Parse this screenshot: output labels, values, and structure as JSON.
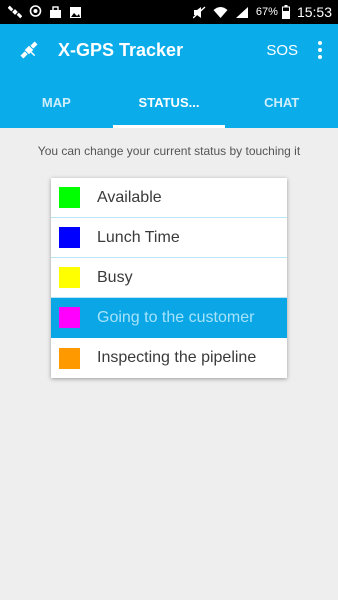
{
  "status_bar": {
    "battery": "67%",
    "time": "15:53"
  },
  "app_bar": {
    "title": "X-GPS Tracker",
    "sos_label": "SOS"
  },
  "tabs": [
    {
      "label": "MAP"
    },
    {
      "label": "STATUS..."
    },
    {
      "label": "CHAT"
    }
  ],
  "hint": "You can change your current status by touching it",
  "statuses": [
    {
      "label": "Available",
      "color": "#00ff00"
    },
    {
      "label": "Lunch Time",
      "color": "#0000ff"
    },
    {
      "label": "Busy",
      "color": "#ffff00"
    },
    {
      "label": "Going to the customer",
      "color": "#ff00ff"
    },
    {
      "label": "Inspecting the pipeline",
      "color": "#ff9900"
    }
  ],
  "selected_status": "Going to the customer"
}
